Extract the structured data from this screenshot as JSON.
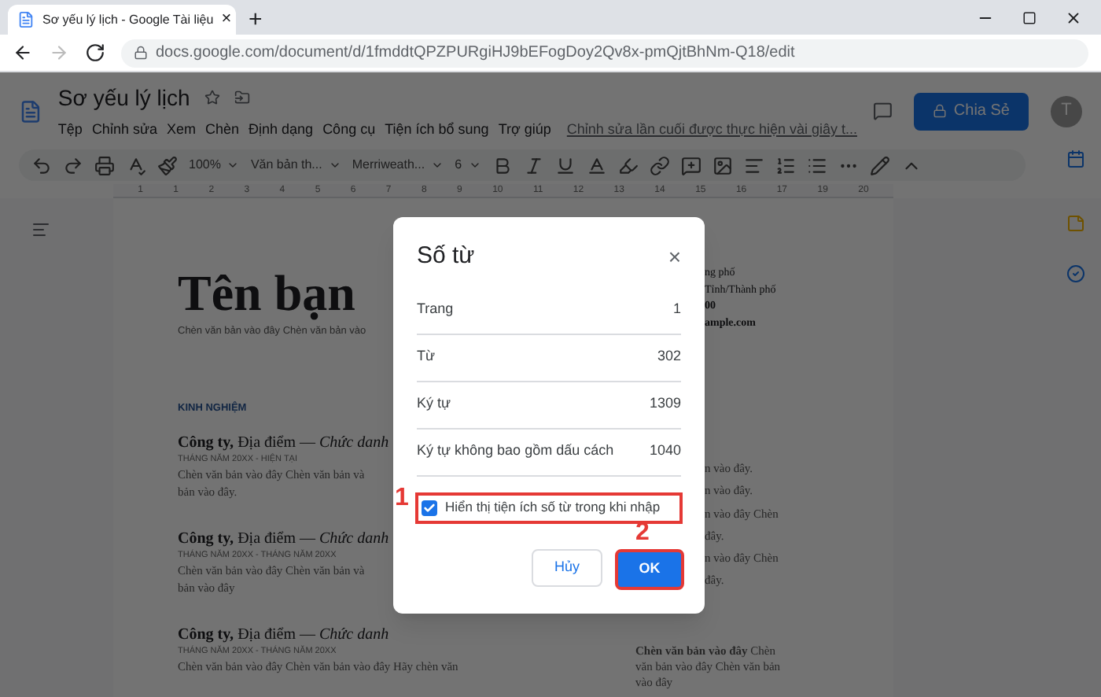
{
  "browser": {
    "tab_title": "Sơ yếu lý lịch - Google Tài liệu",
    "tab_close": "×",
    "new_tab": "+",
    "url": "docs.google.com/document/d/1fmddtQPZPURgiHJ9bEFogDoy2Qv8x-pmQjtBhNm-Q18/edit"
  },
  "header": {
    "title": "Sơ yếu lý lịch",
    "menu": [
      "Tệp",
      "Chỉnh sửa",
      "Xem",
      "Chèn",
      "Định dạng",
      "Công cụ",
      "Tiện ích bổ sung",
      "Trợ giúp"
    ],
    "last_edit": "Chỉnh sửa lần cuối được thực hiện vài giây t...",
    "share_button": "Chia Sẻ",
    "avatar": "T"
  },
  "toolbar": {
    "dropdowns": [
      "100%",
      "Văn bản th...",
      "Merriweath...",
      "6"
    ]
  },
  "ruler": [
    "1",
    "1",
    "2",
    "3",
    "4",
    "5",
    "6",
    "7",
    "8",
    "9",
    "10",
    "11",
    "12",
    "13",
    "14",
    "15",
    "16",
    "17",
    "19",
    "20"
  ],
  "document": {
    "name": "Tên bạn",
    "subtitle": "Chèn văn bản vào đây Chèn văn bản vào",
    "section": "KINH NGHIỆM",
    "entries": [
      {
        "title": "**Công ty,** Địa điểm — *Chức danh*",
        "date": "THÁNG NĂM 20XX - HIỆN TẠI",
        "body": [
          "Chèn văn bản vào đây Chèn văn bản và",
          "bản vào đây."
        ]
      },
      {
        "title": "**Công ty,** Địa điểm — *Chức danh*",
        "date": "THÁNG NĂM 20XX - THÁNG NĂM 20XX",
        "body": [
          "Chèn văn bản vào đây Chèn văn bản và",
          "bản vào đây"
        ]
      },
      {
        "title": "**Công ty,** Địa điểm — *Chức danh*",
        "date": "THÁNG NĂM 20XX - THÁNG NĂM 20XX",
        "body": [
          "Chèn văn bản vào đây Chèn văn bản vào đây Hãy chèn văn"
        ]
      }
    ],
    "contact": [
      "ng phố",
      "Tỉnh/Thành phố",
      "00",
      "ample.com"
    ],
    "right_fragments": [
      "n vào đây.",
      "n vào đây.",
      "n vào đây Chèn",
      "đây.",
      "n vào đây Chèn",
      "đây."
    ],
    "right_paragraph": [
      "**Chèn văn bản vào đây** Chèn",
      "văn bản vào đây Chèn văn bản",
      "vào đây"
    ]
  },
  "dialog": {
    "title": "Số từ",
    "close": "×",
    "rows": [
      {
        "label": "Trang",
        "value": "1"
      },
      {
        "label": "Từ",
        "value": "302"
      },
      {
        "label": "Ký tự",
        "value": "1309"
      },
      {
        "label": "Ký tự không bao gồm dấu cách",
        "value": "1040"
      }
    ],
    "checkbox": {
      "label": "Hiển thị tiện ích số từ trong khi nhập",
      "checked": true
    },
    "cancel": "Hủy",
    "ok": "OK"
  },
  "annotations": [
    "1",
    "2"
  ]
}
